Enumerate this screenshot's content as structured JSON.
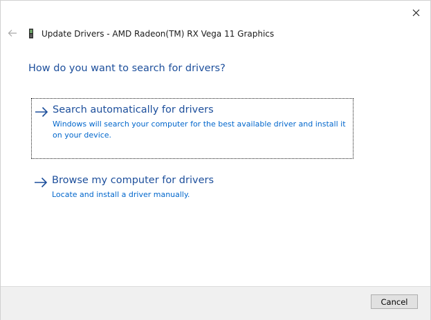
{
  "window": {
    "title": "Update Drivers - AMD Radeon(TM) RX Vega 11 Graphics"
  },
  "heading": "How do you want to search for drivers?",
  "options": [
    {
      "title": "Search automatically for drivers",
      "description": "Windows will search your computer for the best available driver and install it on your device.",
      "focused": true
    },
    {
      "title": "Browse my computer for drivers",
      "description": "Locate and install a driver manually.",
      "focused": false
    }
  ],
  "footer": {
    "cancel_label": "Cancel"
  },
  "icons": {
    "close": "close-icon",
    "back": "back-arrow-icon",
    "device": "graphics-card-icon",
    "option_arrow": "right-arrow-icon"
  },
  "colors": {
    "heading": "#1c4e9b",
    "description": "#0066cc",
    "footer_bg": "#f0f0f0"
  }
}
